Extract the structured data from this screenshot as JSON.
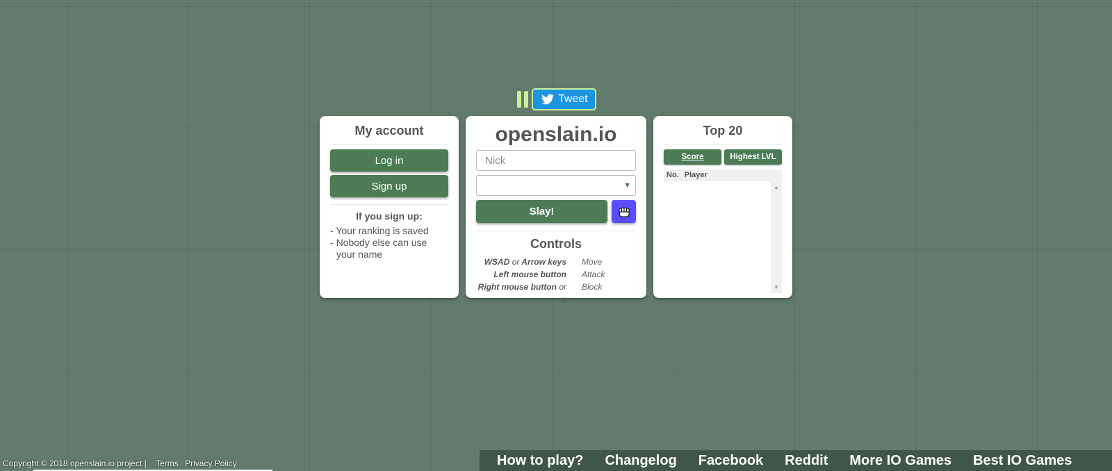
{
  "social": {
    "tweet_label": "Tweet",
    "icons": [
      "facebook-like-icon",
      "twitter-bird-icon"
    ]
  },
  "account": {
    "title": "My account",
    "login_label": "Log in",
    "signup_label": "Sign up",
    "signup_heading": "If you sign up:",
    "perks": [
      "Your ranking is saved",
      "Nobody else can use your name"
    ]
  },
  "game": {
    "title": "openslain.io",
    "nick_placeholder": "Nick",
    "select_value": "",
    "play_label": "Slay!",
    "fist_icon": "fist-icon",
    "controls_title": "Controls",
    "controls": [
      {
        "key": "WSAD",
        "or": "or",
        "key2": "Arrow keys",
        "action": "Move"
      },
      {
        "key": "Left mouse button",
        "or": "",
        "key2": "",
        "action": "Attack"
      },
      {
        "key": "Right mouse button",
        "or": "or",
        "key2": "x",
        "action": "Block"
      }
    ]
  },
  "leaderboard": {
    "title": "Top 20",
    "tabs": [
      "Score",
      "Highest LVL"
    ],
    "active_tab": "Score",
    "columns": [
      "No.",
      "Player"
    ],
    "rows": []
  },
  "footer": {
    "copyright": "Copyright © 2018 openslain.io project |",
    "terms": "Terms",
    "privacy": "Privacy Policy",
    "links": [
      "How to play?",
      "Changelog",
      "Facebook",
      "Reddit",
      "More IO Games",
      "Best IO Games"
    ]
  },
  "colors": {
    "background": "#627b6d",
    "button_green": "#4b7c55",
    "fist_button": "#5a4cff",
    "tweet_blue": "#1b95e0",
    "links_bar": "#3f5648"
  }
}
